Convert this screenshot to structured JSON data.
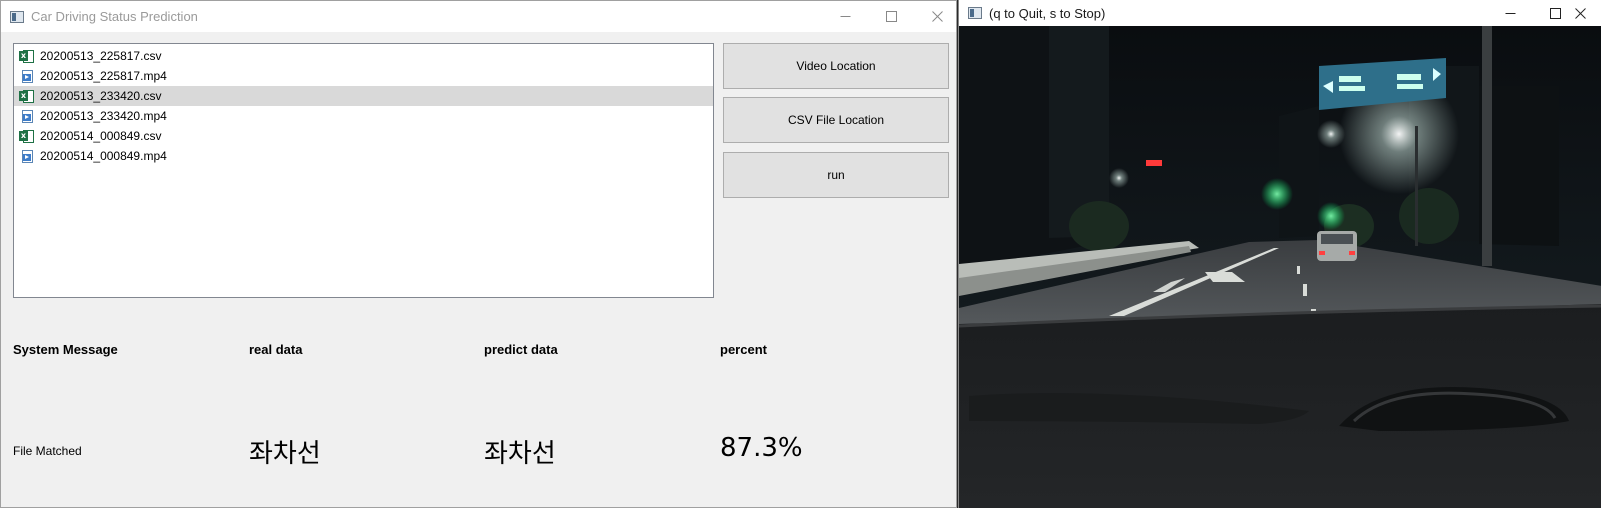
{
  "left_window": {
    "title": "Car Driving Status Prediction",
    "files": [
      {
        "name": "20200513_225817.csv",
        "type": "csv",
        "selected": false
      },
      {
        "name": "20200513_225817.mp4",
        "type": "mp4",
        "selected": false
      },
      {
        "name": "20200513_233420.csv",
        "type": "csv",
        "selected": true
      },
      {
        "name": "20200513_233420.mp4",
        "type": "mp4",
        "selected": false
      },
      {
        "name": "20200514_000849.csv",
        "type": "csv",
        "selected": false
      },
      {
        "name": "20200514_000849.mp4",
        "type": "mp4",
        "selected": false
      }
    ],
    "buttons": {
      "video_location": "Video Location",
      "csv_location": "CSV File Location",
      "run": "run"
    },
    "headers": {
      "system_message": "System Message",
      "real_data": "real data",
      "predict_data": "predict data",
      "percent": "percent"
    },
    "values": {
      "system_message": "File Matched",
      "real_data": "좌차선",
      "predict_data": "좌차선",
      "percent": "87.3%"
    }
  },
  "right_window": {
    "title": "(q to Quit, s to Stop)",
    "content": "night driving dashcam video frame"
  }
}
